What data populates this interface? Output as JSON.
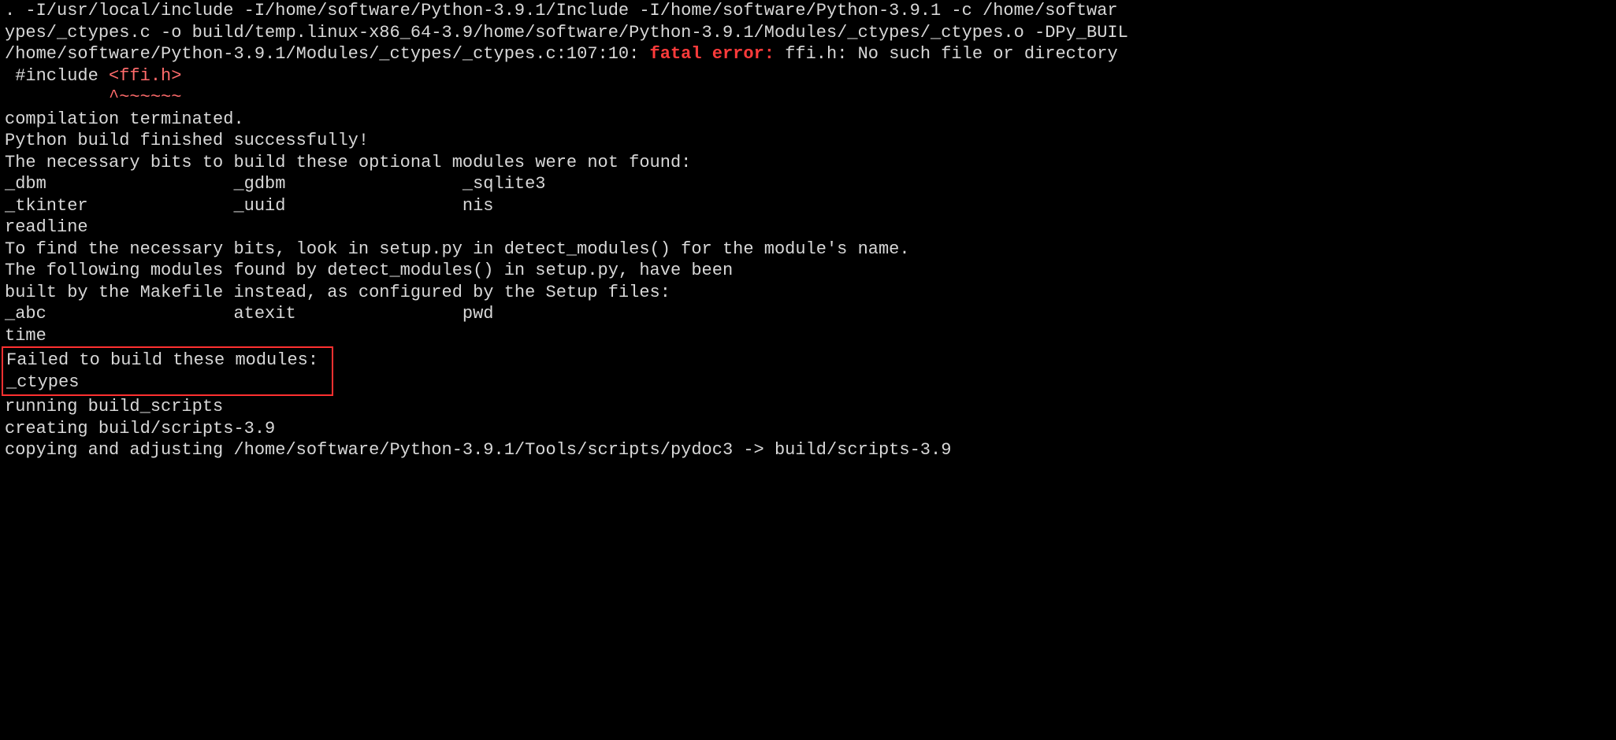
{
  "terminal": {
    "line01_a": ". -I/usr/local/include -I/home/software/Python-3.9.1/Include -I/home/software/Python-3.9.1 -c /home/softwar",
    "line02_a": "ypes/_ctypes.c -o build/temp.linux-x86_64-3.9/home/software/Python-3.9.1/Modules/_ctypes/_ctypes.o -DPy_BUIL",
    "line03_a": "/home/software/Python-3.9.1/Modules/_ctypes/_ctypes.c:107:10: ",
    "line03_err": "fatal error: ",
    "line03_b": "ffi.h: No such file or directory",
    "line04_a": " #include ",
    "line04_inc": "<ffi.h>",
    "line05_marker": "          ^~~~~~~",
    "line06": "compilation terminated.",
    "blank": "",
    "line08": "Python build finished successfully!",
    "line09": "The necessary bits to build these optional modules were not found:",
    "line10": "_dbm                  _gdbm                 _sqlite3           ",
    "line11": "_tkinter              _uuid                 nis                ",
    "line12": "readline                                                       ",
    "line13": "To find the necessary bits, look in setup.py in detect_modules() for the module's name.",
    "line16": "The following modules found by detect_modules() in setup.py, have been",
    "line17": "built by the Makefile instead, as configured by the Setup files:",
    "line18": "_abc                  atexit                pwd                ",
    "line19": "time                                                           ",
    "failed_header": "Failed to build these modules:",
    "failed_mod": "_ctypes                        ",
    "line24": "running build_scripts",
    "line25": "creating build/scripts-3.9",
    "line26": "copying and adjusting /home/software/Python-3.9.1/Tools/scripts/pydoc3 -> build/scripts-3.9"
  }
}
